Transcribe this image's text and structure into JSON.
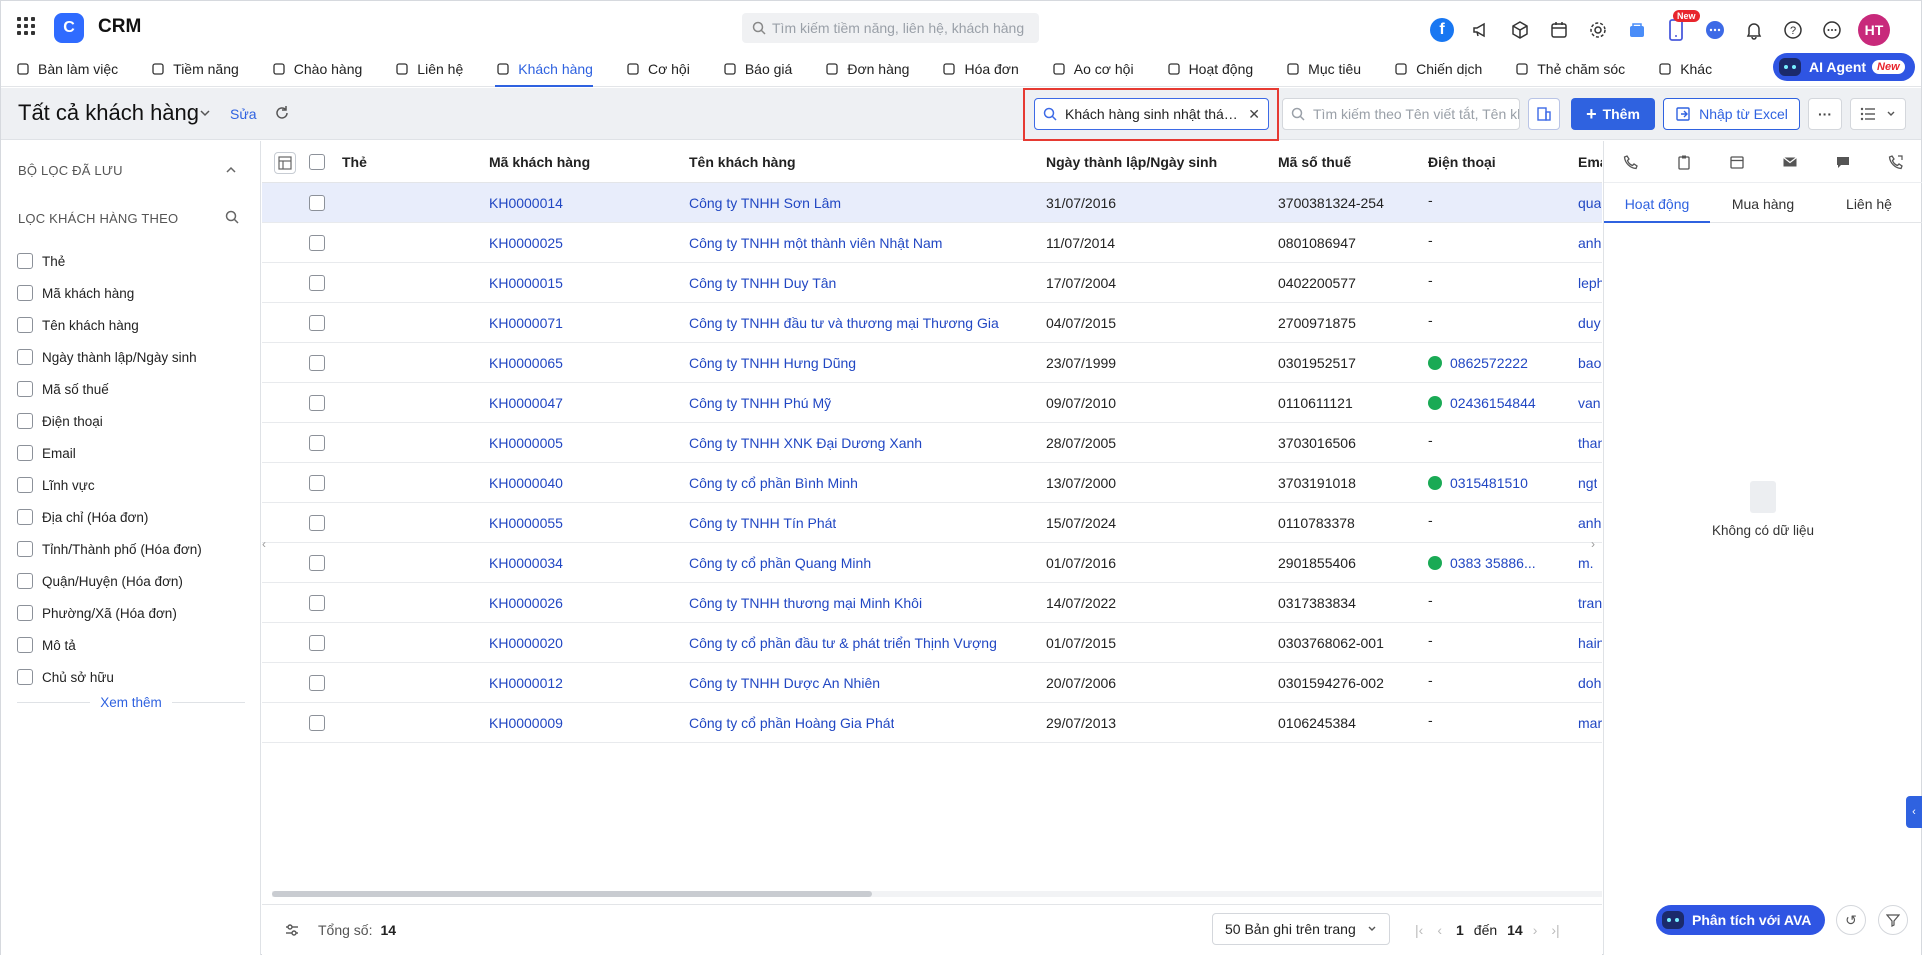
{
  "app": {
    "name": "CRM",
    "logo_letter": "C"
  },
  "global_search": {
    "placeholder": "Tìm kiếm tiềm năng, liên hệ, khách hàng"
  },
  "top_icons": {
    "facebook": "f",
    "new_badge": "New",
    "avatar_initials": "HT"
  },
  "nav": {
    "items": [
      {
        "label": "Bàn làm việc",
        "icon": "home-icon"
      },
      {
        "label": "Tiềm năng",
        "icon": "user-icon"
      },
      {
        "label": "Chào hàng",
        "icon": "magnet-icon"
      },
      {
        "label": "Liên hệ",
        "icon": "contact-icon"
      },
      {
        "label": "Khách hàng",
        "icon": "building-icon",
        "active": true
      },
      {
        "label": "Cơ hội",
        "icon": "wallet-icon"
      },
      {
        "label": "Báo giá",
        "icon": "document-icon"
      },
      {
        "label": "Đơn hàng",
        "icon": "cart-icon"
      },
      {
        "label": "Hóa đơn",
        "icon": "invoice-icon"
      },
      {
        "label": "Ao cơ hội",
        "icon": "funnel-icon"
      },
      {
        "label": "Hoạt động",
        "icon": "activity-icon"
      },
      {
        "label": "Mục tiêu",
        "icon": "target-icon"
      },
      {
        "label": "Chiến dịch",
        "icon": "megaphone-icon"
      },
      {
        "label": "Thẻ chăm sóc",
        "icon": "care-icon"
      },
      {
        "label": "Khác",
        "icon": "menu-icon"
      }
    ],
    "ai_agent": {
      "label": "AI Agent",
      "badge": "New"
    }
  },
  "toolbar": {
    "title": "Tất cả khách hàng",
    "edit_label": "Sửa",
    "filter_chip": "Khách hàng sinh nhật tháng này",
    "search_placeholder": "Tìm kiếm theo Tên viết tắt, Tên khách hàng",
    "add_label": "Thêm",
    "import_label": "Nhập từ Excel",
    "more_label": "···"
  },
  "sidebar": {
    "saved_filters_label": "BỘ LỌC ĐÃ LƯU",
    "filter_by_label": "LỌC KHÁCH HÀNG THEO",
    "filters": [
      "Thẻ",
      "Mã khách hàng",
      "Tên khách hàng",
      "Ngày thành lập/Ngày sinh",
      "Mã số thuế",
      "Điện thoại",
      "Email",
      "Lĩnh vực",
      "Địa chỉ (Hóa đơn)",
      "Tỉnh/Thành phố (Hóa đơn)",
      "Quận/Huyện (Hóa đơn)",
      "Phường/Xã (Hóa đơn)",
      "Mô tả",
      "Chủ sở hữu"
    ],
    "see_more_label": "Xem thêm"
  },
  "table": {
    "columns": {
      "tag": "Thẻ",
      "code": "Mã khách hàng",
      "name": "Tên khách hàng",
      "date": "Ngày thành lập/Ngày sinh",
      "tax": "Mã số thuế",
      "phone": "Điện thoại",
      "email": "Ema"
    },
    "rows": [
      {
        "code": "KH0000014",
        "name": "Công ty TNHH Sơn Lâm",
        "date": "31/07/2016",
        "tax": "3700381324-254",
        "phone": "-",
        "whatsapp": false,
        "email": "qua",
        "selected": true
      },
      {
        "code": "KH0000025",
        "name": "Công ty TNHH một thành viên Nhật Nam",
        "date": "11/07/2014",
        "tax": "0801086947",
        "phone": "-",
        "whatsapp": false,
        "email": "anh"
      },
      {
        "code": "KH0000015",
        "name": "Công ty TNHH Duy Tân",
        "date": "17/07/2004",
        "tax": "0402200577",
        "phone": "-",
        "whatsapp": false,
        "email": "leph"
      },
      {
        "code": "KH0000071",
        "name": "Công ty TNHH đầu tư và thương mại Thương Gia",
        "date": "04/07/2015",
        "tax": "2700971875",
        "phone": "-",
        "whatsapp": false,
        "email": "duy"
      },
      {
        "code": "KH0000065",
        "name": "Công ty TNHH Hưng Dũng",
        "date": "23/07/1999",
        "tax": "0301952517",
        "phone": "0862572222",
        "whatsapp": true,
        "email": "bao"
      },
      {
        "code": "KH0000047",
        "name": "Công ty TNHH Phú Mỹ",
        "date": "09/07/2010",
        "tax": "0110611121",
        "phone": "02436154844",
        "whatsapp": true,
        "email": "van"
      },
      {
        "code": "KH0000005",
        "name": "Công ty TNHH XNK Đại Dương Xanh",
        "date": "28/07/2005",
        "tax": "3703016506",
        "phone": "-",
        "whatsapp": false,
        "email": "than"
      },
      {
        "code": "KH0000040",
        "name": "Công ty cổ phần Bình Minh",
        "date": "13/07/2000",
        "tax": "3703191018",
        "phone": "0315481510",
        "whatsapp": true,
        "email": "ngt"
      },
      {
        "code": "KH0000055",
        "name": "Công ty TNHH Tín Phát",
        "date": "15/07/2024",
        "tax": "0110783378",
        "phone": "-",
        "whatsapp": false,
        "email": "anh"
      },
      {
        "code": "KH0000034",
        "name": "Công ty cổ phần Quang Minh",
        "date": "01/07/2016",
        "tax": "2901855406",
        "phone": "0383 35886...",
        "whatsapp": true,
        "email": "m."
      },
      {
        "code": "KH0000026",
        "name": "Công ty TNHH thương mại Minh Khôi",
        "date": "14/07/2022",
        "tax": "0317383834",
        "phone": "-",
        "whatsapp": false,
        "email": "tran"
      },
      {
        "code": "KH0000020",
        "name": "Công ty cổ phần đầu tư & phát triển Thịnh Vượng",
        "date": "01/07/2015",
        "tax": "0303768062-001",
        "phone": "-",
        "whatsapp": false,
        "email": "hain"
      },
      {
        "code": "KH0000012",
        "name": "Công ty TNHH Dược An Nhiên",
        "date": "20/07/2006",
        "tax": "0301594276-002",
        "phone": "-",
        "whatsapp": false,
        "email": "doh"
      },
      {
        "code": "KH0000009",
        "name": "Công ty cổ phần Hoàng Gia Phát",
        "date": "29/07/2013",
        "tax": "0106245384",
        "phone": "-",
        "whatsapp": false,
        "email": "mar"
      }
    ]
  },
  "footer": {
    "total_label": "Tổng số:",
    "total": "14",
    "per_page": "50 Bản ghi trên trang",
    "page_from": "1",
    "page_to_label": "đến",
    "page_to": "14"
  },
  "right_panel": {
    "tabs": [
      "Hoạt động",
      "Mua hàng",
      "Liên hệ"
    ],
    "active_tab": 0,
    "empty_text": "Không có dữ liệu",
    "ava_label": "Phân tích với AVA"
  },
  "colors": {
    "accent": "#2f62e0",
    "highlight_border": "#e63a32",
    "selected_row": "#e8edfb"
  }
}
